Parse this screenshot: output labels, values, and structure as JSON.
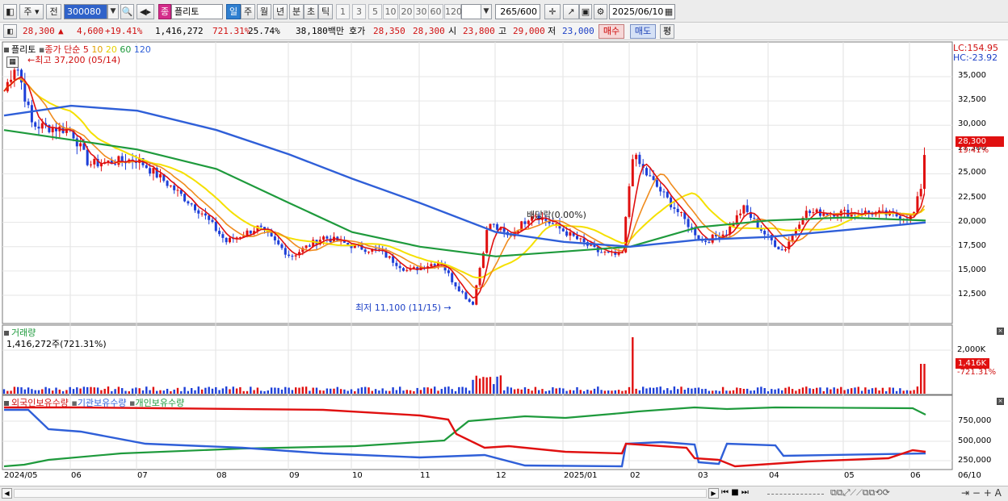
{
  "toolbar": {
    "market_label": "주",
    "prev_label": "전",
    "code": "300080",
    "stock_badge": "종",
    "stock_name": "플리토",
    "periods": [
      "일",
      "주",
      "월",
      "년",
      "분",
      "초",
      "틱"
    ],
    "selected_period": "일",
    "intervals": [
      "1",
      "3",
      "5",
      "10",
      "20",
      "30",
      "60",
      "120"
    ],
    "count": "265",
    "count_total": "/600",
    "date": "2025/06/10"
  },
  "quote": {
    "price": "28,300",
    "change_sign": "▲",
    "change": "4,600",
    "change_rate": "+19.41%",
    "volume": "1,416,272",
    "volume_rate": "721.31%",
    "turnover": "25.74%",
    "amount": "38,180백만",
    "bid_label": "호가",
    "bid": "28,350",
    "ask": "28,300",
    "open_label": "시",
    "open": "23,800",
    "high_label": "고",
    "high": "29,000",
    "low_label": "저",
    "low": "23,000",
    "buy_label": "매수",
    "sell_label": "매도",
    "flat_label": "평"
  },
  "price_panel": {
    "title": "플리토",
    "series_label": "종가 단순",
    "ma_labels": [
      "5",
      "10",
      "20",
      "60",
      "120"
    ],
    "high_note": "최고 37,200 (05/14)",
    "low_note": "최저 11,100 (11/15)",
    "ex_note": "배당락(0.00%)",
    "lc": "LC:154.95",
    "hc": "HC:-23.92",
    "y_ticks": [
      "35,000",
      "32,500",
      "30,000",
      "27,500",
      "25,000",
      "22,500",
      "20,000",
      "17,500",
      "15,000",
      "12,500"
    ],
    "last_price": "28,300",
    "last_rate": "19.41%"
  },
  "volume_panel": {
    "title": "거래량",
    "value": "1,416,272주(721.31%)",
    "y_tick": "2,000K",
    "last_value": "1,416K",
    "last_rate": "-721.31%"
  },
  "holding_panel": {
    "legend": [
      "외국인보유수량",
      "기관보유수량",
      "개인보유수량"
    ],
    "y_ticks": [
      "750,000",
      "500,000",
      "250,000"
    ]
  },
  "x_labels": [
    "2024/05",
    "06",
    "07",
    "08",
    "09",
    "10",
    "11",
    "12",
    "2025/01",
    "02",
    "03",
    "04",
    "05",
    "06",
    "06/10"
  ],
  "chart_data": {
    "type": "line",
    "x": [
      "2024/05",
      "06",
      "07",
      "08",
      "09",
      "10",
      "11",
      "12",
      "2025/01",
      "02",
      "03",
      "04",
      "05",
      "06"
    ],
    "series": [
      {
        "name": "종가",
        "values": [
          33500,
          30000,
          26500,
          21000,
          17500,
          17500,
          15000,
          20000,
          18000,
          24000,
          19000,
          18500,
          21500,
          20500
        ]
      },
      {
        "name": "120",
        "values": [
          31000,
          32000,
          31500,
          29500,
          27000,
          24500,
          22000,
          19000,
          18000,
          17500,
          18200,
          18500,
          19200,
          20000
        ]
      },
      {
        "name": "60",
        "values": [
          29500,
          28500,
          27500,
          25500,
          22000,
          19000,
          17500,
          16500,
          17000,
          17500,
          19500,
          20200,
          20500,
          20200
        ]
      }
    ],
    "colors": {
      "up": "#e01010",
      "down": "#1d3fd8",
      "ma5": "#e01010",
      "ma10": "#f08c1e",
      "ma20": "#f5e000",
      "ma60": "#1e9a3c",
      "ma120": "#2f5fd8"
    },
    "ylim": [
      10000,
      37500
    ]
  }
}
